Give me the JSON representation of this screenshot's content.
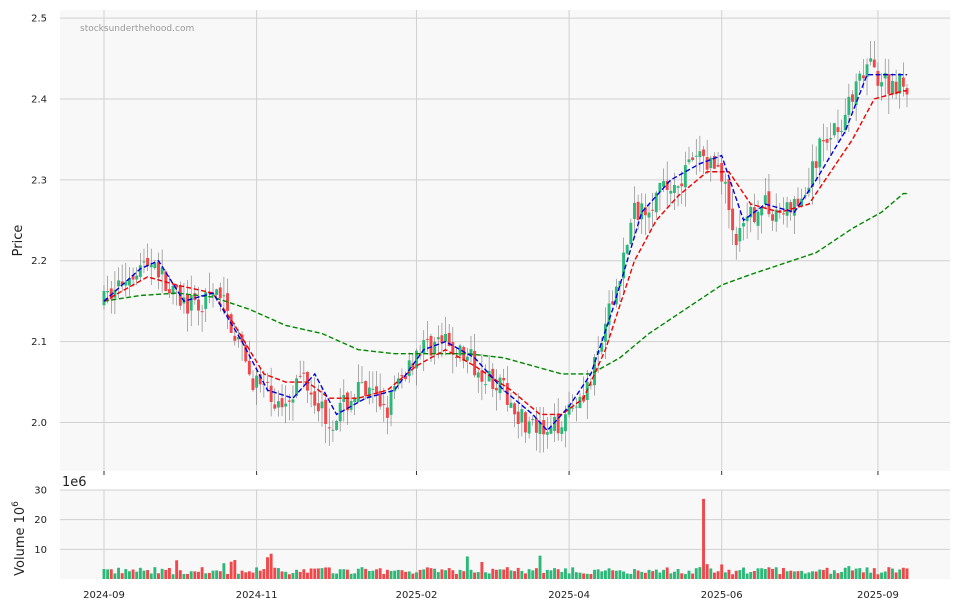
{
  "watermark": "stocksunderthehood.com",
  "colors": {
    "up": "#2db87a",
    "down": "#f0484a",
    "ma_fast": "#0000dd",
    "ma_mid": "#ee0000",
    "ma_slow": "#008800",
    "grid": "#d0d0d0",
    "panel_bg": "#f8f8f8"
  },
  "chart_data": [
    {
      "type": "candlestick",
      "ylabel": "Price",
      "ylim": [
        1.94,
        2.51
      ],
      "yticks": [
        "2.0",
        "2.1",
        "2.2",
        "2.3",
        "2.4",
        "2.5"
      ],
      "x_ticks": [
        "2024-09",
        "2024-11",
        "2025-02",
        "2025-04",
        "2025-06",
        "2025-09"
      ],
      "grid": true,
      "legend": "none",
      "price_waypoints": [
        [
          0,
          2.15
        ],
        [
          8,
          2.19
        ],
        [
          14,
          2.2
        ],
        [
          18,
          2.16
        ],
        [
          25,
          2.14
        ],
        [
          32,
          2.16
        ],
        [
          40,
          2.06
        ],
        [
          48,
          2.02
        ],
        [
          55,
          2.06
        ],
        [
          62,
          2.0
        ],
        [
          70,
          2.04
        ],
        [
          78,
          2.02
        ],
        [
          86,
          2.09
        ],
        [
          92,
          2.1
        ],
        [
          100,
          2.08
        ],
        [
          108,
          2.05
        ],
        [
          116,
          2.0
        ],
        [
          122,
          1.98
        ],
        [
          128,
          2.02
        ],
        [
          134,
          2.05
        ],
        [
          140,
          2.15
        ],
        [
          146,
          2.26
        ],
        [
          152,
          2.28
        ],
        [
          158,
          2.3
        ],
        [
          164,
          2.33
        ],
        [
          170,
          2.31
        ],
        [
          174,
          2.22
        ],
        [
          180,
          2.27
        ],
        [
          186,
          2.26
        ],
        [
          192,
          2.27
        ],
        [
          198,
          2.35
        ],
        [
          204,
          2.38
        ],
        [
          210,
          2.44
        ],
        [
          216,
          2.42
        ],
        [
          220,
          2.42
        ]
      ],
      "ma_fast_waypoints": [
        [
          0,
          2.15
        ],
        [
          10,
          2.19
        ],
        [
          15,
          2.2
        ],
        [
          22,
          2.15
        ],
        [
          30,
          2.16
        ],
        [
          38,
          2.1
        ],
        [
          45,
          2.04
        ],
        [
          52,
          2.03
        ],
        [
          58,
          2.06
        ],
        [
          64,
          2.01
        ],
        [
          72,
          2.03
        ],
        [
          80,
          2.04
        ],
        [
          88,
          2.09
        ],
        [
          94,
          2.1
        ],
        [
          102,
          2.08
        ],
        [
          110,
          2.04
        ],
        [
          118,
          2.01
        ],
        [
          122,
          1.99
        ],
        [
          128,
          2.02
        ],
        [
          134,
          2.06
        ],
        [
          140,
          2.14
        ],
        [
          148,
          2.26
        ],
        [
          156,
          2.3
        ],
        [
          164,
          2.32
        ],
        [
          170,
          2.33
        ],
        [
          176,
          2.25
        ],
        [
          182,
          2.27
        ],
        [
          190,
          2.26
        ],
        [
          196,
          2.3
        ],
        [
          204,
          2.36
        ],
        [
          210,
          2.43
        ],
        [
          216,
          2.43
        ],
        [
          220,
          2.43
        ]
      ],
      "ma_mid_waypoints": [
        [
          0,
          2.15
        ],
        [
          12,
          2.18
        ],
        [
          20,
          2.17
        ],
        [
          30,
          2.16
        ],
        [
          36,
          2.12
        ],
        [
          44,
          2.06
        ],
        [
          50,
          2.05
        ],
        [
          56,
          2.05
        ],
        [
          62,
          2.03
        ],
        [
          70,
          2.03
        ],
        [
          78,
          2.04
        ],
        [
          86,
          2.07
        ],
        [
          94,
          2.09
        ],
        [
          102,
          2.07
        ],
        [
          112,
          2.04
        ],
        [
          120,
          2.01
        ],
        [
          126,
          2.01
        ],
        [
          132,
          2.03
        ],
        [
          138,
          2.09
        ],
        [
          146,
          2.2
        ],
        [
          152,
          2.25
        ],
        [
          158,
          2.28
        ],
        [
          166,
          2.31
        ],
        [
          172,
          2.31
        ],
        [
          178,
          2.27
        ],
        [
          186,
          2.26
        ],
        [
          194,
          2.27
        ],
        [
          200,
          2.31
        ],
        [
          206,
          2.35
        ],
        [
          212,
          2.4
        ],
        [
          220,
          2.41
        ]
      ],
      "ma_slow_waypoints": [
        [
          0,
          2.15
        ],
        [
          10,
          2.157
        ],
        [
          20,
          2.16
        ],
        [
          30,
          2.155
        ],
        [
          40,
          2.14
        ],
        [
          50,
          2.12
        ],
        [
          60,
          2.11
        ],
        [
          70,
          2.09
        ],
        [
          80,
          2.085
        ],
        [
          90,
          2.085
        ],
        [
          100,
          2.085
        ],
        [
          110,
          2.08
        ],
        [
          118,
          2.07
        ],
        [
          126,
          2.06
        ],
        [
          134,
          2.06
        ],
        [
          142,
          2.08
        ],
        [
          150,
          2.11
        ],
        [
          160,
          2.14
        ],
        [
          170,
          2.17
        ],
        [
          178,
          2.183
        ],
        [
          186,
          2.195
        ],
        [
          196,
          2.21
        ],
        [
          206,
          2.24
        ],
        [
          214,
          2.26
        ],
        [
          220,
          2.283
        ]
      ]
    },
    {
      "type": "bar",
      "ylabel": "Volume  10",
      "ylabel_exp": "6",
      "offset_label": "1e6",
      "ylim": [
        0,
        30
      ],
      "yticks": [
        "10",
        "20",
        "30"
      ],
      "grid": true,
      "spike_index": 165,
      "spike_value": 27
    }
  ]
}
